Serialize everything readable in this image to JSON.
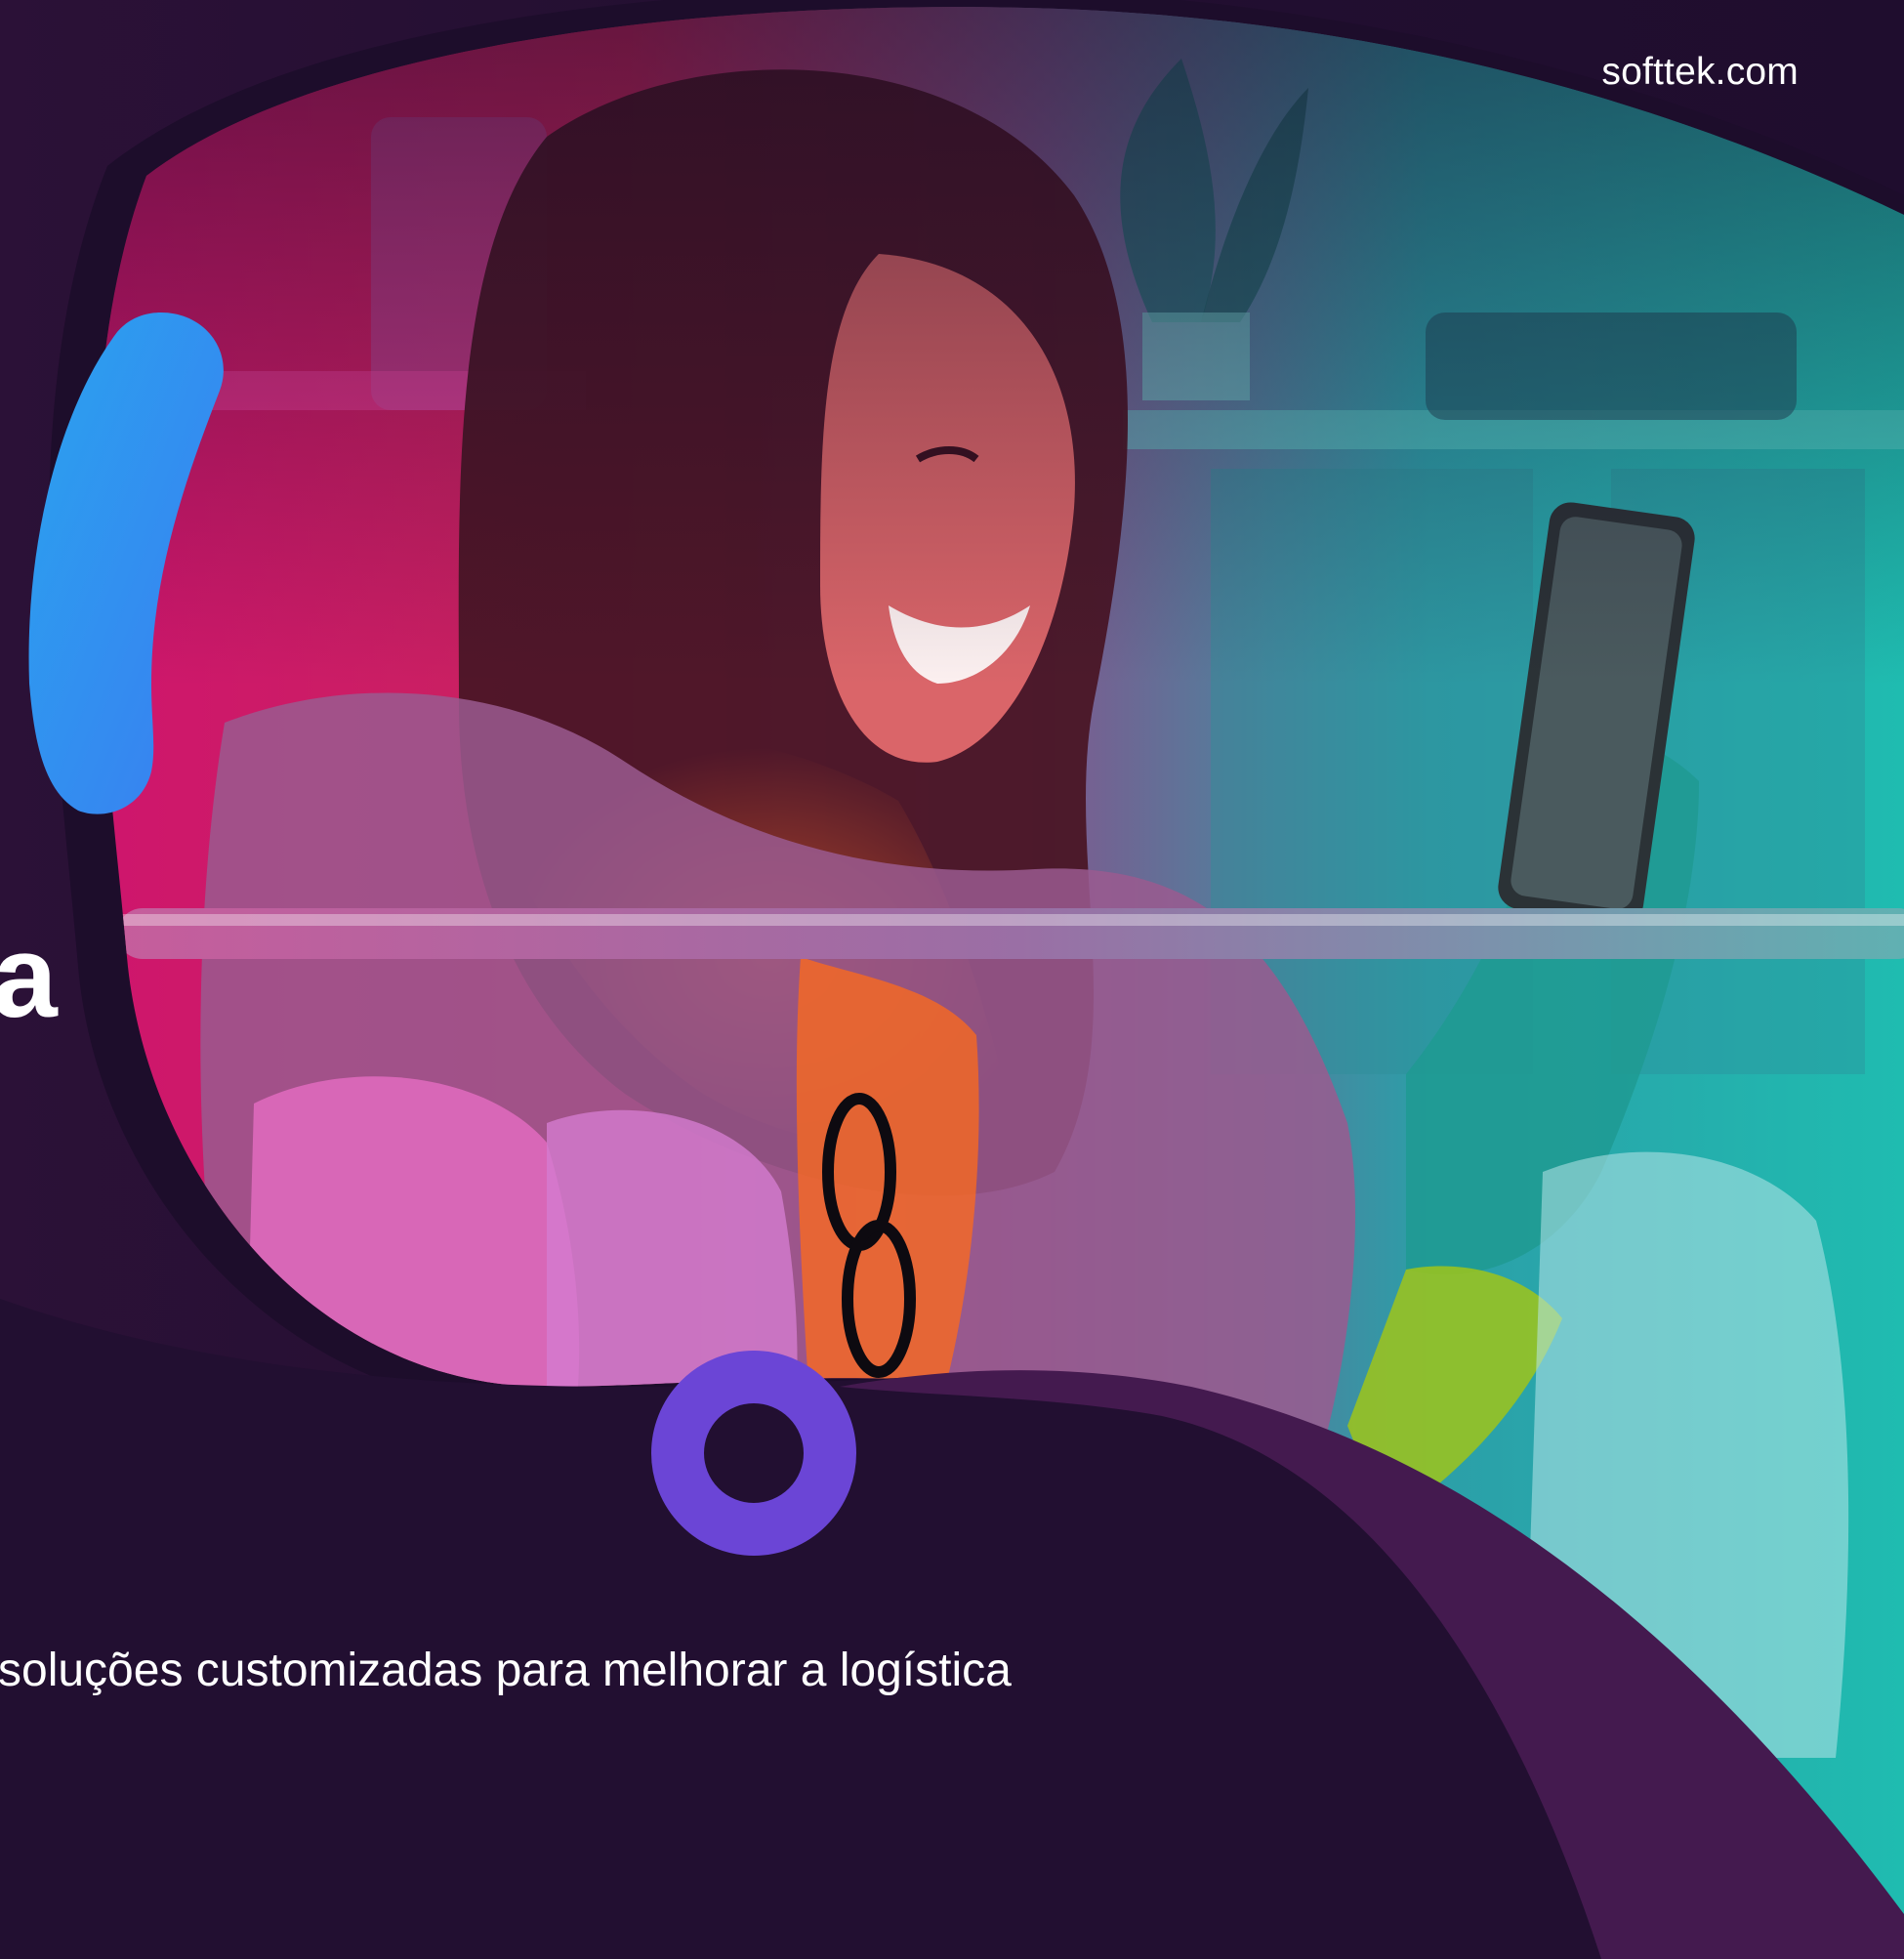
{
  "header": {
    "site_link": "softtek.com"
  },
  "hero": {
    "headline_fragment": "a",
    "subtitle": "soluções customizadas para melhorar a logística",
    "image": "photo of a smiling woman at a clothing rack looking at her smartphone, pink-to-teal color overlay"
  },
  "colors": {
    "background": "#24102f",
    "photo_gradient_left": "#e01a7a",
    "photo_gradient_right": "#1fb9b0",
    "accent_blue": "#2f8ff0",
    "accent_purple": "#6b45d6",
    "wave_purple": "#441a4f"
  },
  "icons": {
    "ring": "ring-icon",
    "arc_accent": "arc-accent-icon"
  }
}
